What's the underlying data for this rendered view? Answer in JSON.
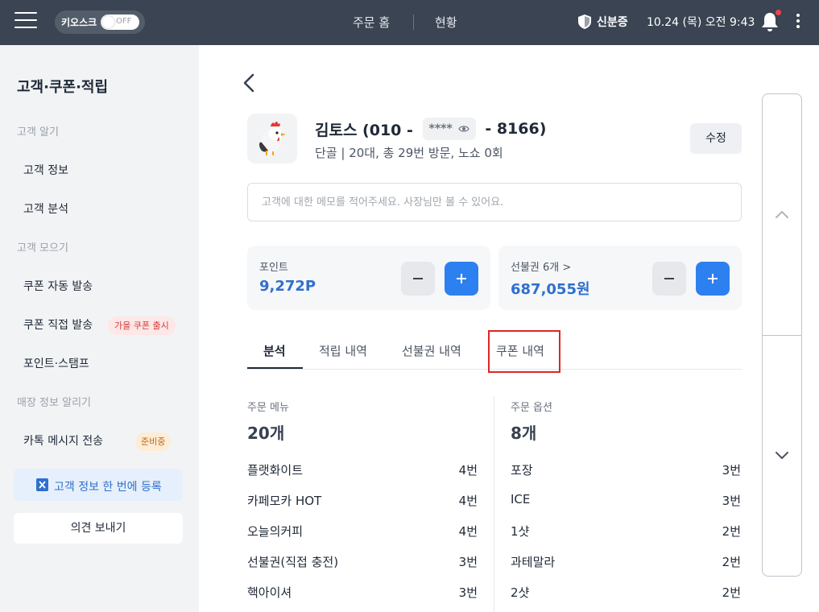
{
  "topbar": {
    "kiosk_label": "키오스크",
    "kiosk_state": "OFF",
    "nav_home": "주문 홈",
    "nav_status": "현황",
    "verify_label": "신분증",
    "datetime": "10.24 (목) 오전 9:43"
  },
  "sidebar": {
    "title": "고객·쿠폰·적립",
    "sections": {
      "know": "고객 알기",
      "gather": "고객 모으기",
      "store": "매장 정보 알리기"
    },
    "items": {
      "customer_info": "고객 정보",
      "customer_analysis": "고객 분석",
      "coupon_auto": "쿠폰 자동 발송",
      "coupon_direct": "쿠폰 직접 발송",
      "coupon_direct_badge": "가을 쿠폰 출시",
      "point_stamp": "포인트·스탬프",
      "kakao_message": "카톡 메시지 전송",
      "kakao_badge": "준비중"
    },
    "register_label": "고객 정보 한 번에 등록",
    "feedback_label": "의견 보내기"
  },
  "customer": {
    "name_prefix": "김토스 (010 -",
    "masked": "****",
    "name_suffix": "- 8166)",
    "summary": "단골 | 20대, 총 29번 방문, 노쇼 0회",
    "edit_label": "수정",
    "memo_placeholder": "고객에 대한 메모를 적어주세요. 사장님만 볼 수 있어요."
  },
  "cards": {
    "points": {
      "label": "포인트",
      "value": "9,272P"
    },
    "prepaid": {
      "label": "선불권 6개 >",
      "value": "687,055원"
    }
  },
  "tabs": [
    "분석",
    "적립 내역",
    "선불권 내역",
    "쿠폰 내역"
  ],
  "analysis": {
    "menu": {
      "title": "주문 메뉴",
      "count": "20개",
      "rows": [
        {
          "name": "플랫화이트",
          "count": "4번"
        },
        {
          "name": "카페모카 HOT",
          "count": "4번"
        },
        {
          "name": "오늘의커피",
          "count": "4번"
        },
        {
          "name": "선불권(직접 충전)",
          "count": "3번"
        },
        {
          "name": "핵아이셔",
          "count": "3번"
        }
      ]
    },
    "options": {
      "title": "주문 옵션",
      "count": "8개",
      "rows": [
        {
          "name": "포장",
          "count": "3번"
        },
        {
          "name": "ICE",
          "count": "3번"
        },
        {
          "name": "1샷",
          "count": "2번"
        },
        {
          "name": "과테말라",
          "count": "2번"
        },
        {
          "name": "2샷",
          "count": "2번"
        }
      ]
    }
  },
  "colors": {
    "topbar": "#3a4452",
    "accent": "#2d80f0",
    "highlight": "#dc2626"
  }
}
